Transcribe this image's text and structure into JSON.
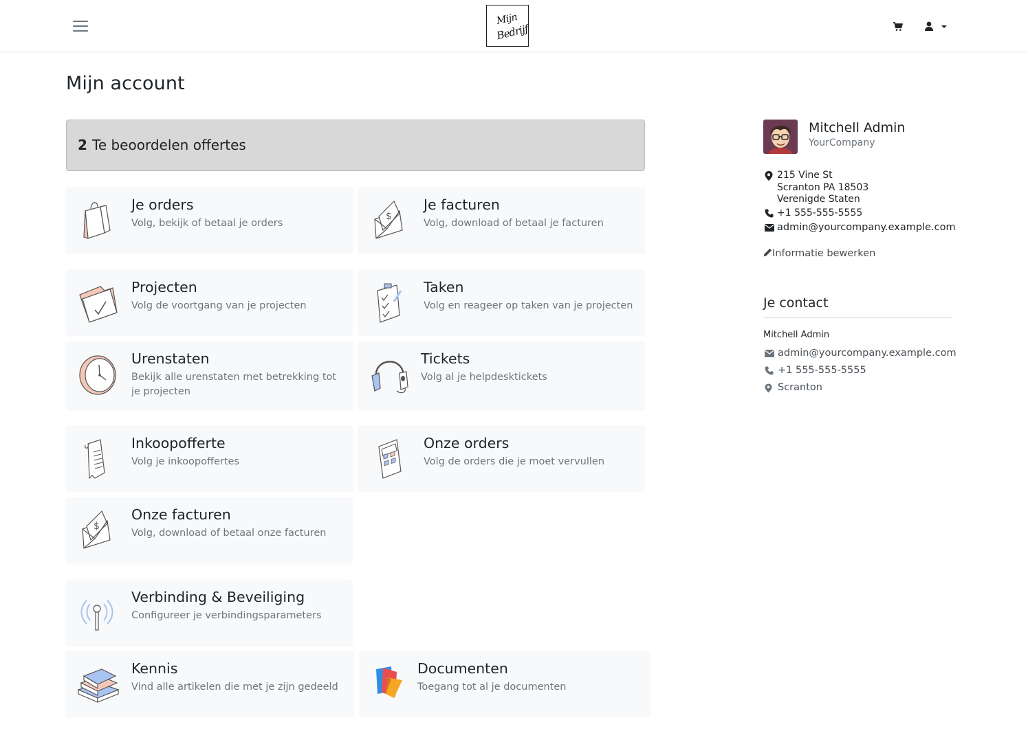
{
  "header": {
    "logo_line1": "Mijn",
    "logo_line2": "Bedrijf",
    "menu_icon": "hamburger-icon",
    "cart_icon": "shopping-cart-icon",
    "user_icon": "user-icon"
  },
  "page_title": "Mijn account",
  "quotes_banner": {
    "count": "2",
    "label": "Te beoordelen offertes"
  },
  "cards": {
    "orders": {
      "title": "Je orders",
      "desc": "Volg, bekijk of betaal je orders"
    },
    "invoices": {
      "title": "Je facturen",
      "desc": "Volg, download of betaal je facturen"
    },
    "projects": {
      "title": "Projecten",
      "desc": "Volg de voortgang van je projecten"
    },
    "tasks": {
      "title": "Taken",
      "desc": "Volg en reageer op taken van je projecten"
    },
    "timesheets": {
      "title": "Urenstaten",
      "desc": "Bekijk alle urenstaten met betrekking tot je projecten"
    },
    "tickets": {
      "title": "Tickets",
      "desc": "Volg al je helpdesktickets"
    },
    "purchase_quotes": {
      "title": "Inkoopofferte",
      "desc": "Volg je inkoopoffertes"
    },
    "our_orders": {
      "title": "Onze orders",
      "desc": "Volg de orders die je moet vervullen"
    },
    "our_invoices": {
      "title": "Onze facturen",
      "desc": "Volg, download of betaal onze facturen"
    },
    "security": {
      "title": "Verbinding & Beveiliging",
      "desc": "Configureer je verbindingsparameters"
    },
    "knowledge": {
      "title": "Kennis",
      "desc": "Vind alle artikelen die met je zijn gedeeld"
    },
    "documents": {
      "title": "Documenten",
      "desc": "Toegang tot al je documenten"
    }
  },
  "profile": {
    "name": "Mitchell Admin",
    "company": "YourCompany",
    "address_line1": "215 Vine St",
    "address_line2": "Scranton PA 18503",
    "address_line3": "Verenigde Staten",
    "phone": "+1 555-555-5555",
    "email": "admin@yourcompany.example.com",
    "edit_label": "Informatie bewerken"
  },
  "contact": {
    "heading": "Je contact",
    "name": "Mitchell Admin",
    "email": "admin@yourcompany.example.com",
    "phone": "+1 555-555-5555",
    "city": "Scranton"
  },
  "colors": {
    "banner_bg": "#d8d8d8",
    "card_bg": "#f8f9fa",
    "icon_accent": "#f4c7b8",
    "icon_blue": "#a9c4f0"
  }
}
